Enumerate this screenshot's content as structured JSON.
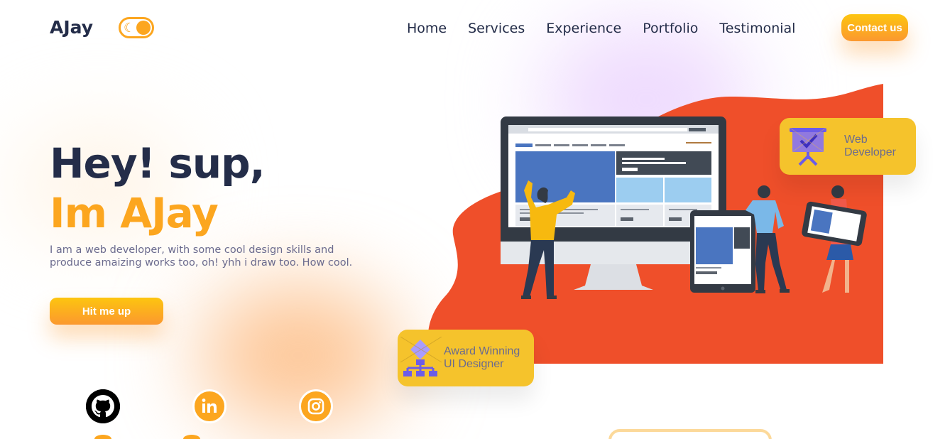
{
  "header": {
    "logo": "AJay",
    "nav": [
      "Home",
      "Services",
      "Experience",
      "Portfolio",
      "Testimonial"
    ],
    "contact_label": "Contact us"
  },
  "intro": {
    "greeting": "Hey! sup,",
    "name": "Im AJay",
    "description": "I am a web developer, with some cool design skills and produce amaizing works too, oh! yhh i draw too. How cool.",
    "cta_label": "Hit me up"
  },
  "cards": {
    "web_line1": "Web",
    "web_line2": "Developer",
    "award_line1": "Award Winning",
    "award_line2": "UI Designer"
  },
  "social": {
    "icons": [
      "github-icon",
      "linkedin-icon",
      "instagram-icon"
    ]
  },
  "colors": {
    "accent": "#fca61f",
    "dark": "#242d49",
    "card": "#f5c32c",
    "blob": "#ef4f2a",
    "muted": "#6b6b8e"
  }
}
